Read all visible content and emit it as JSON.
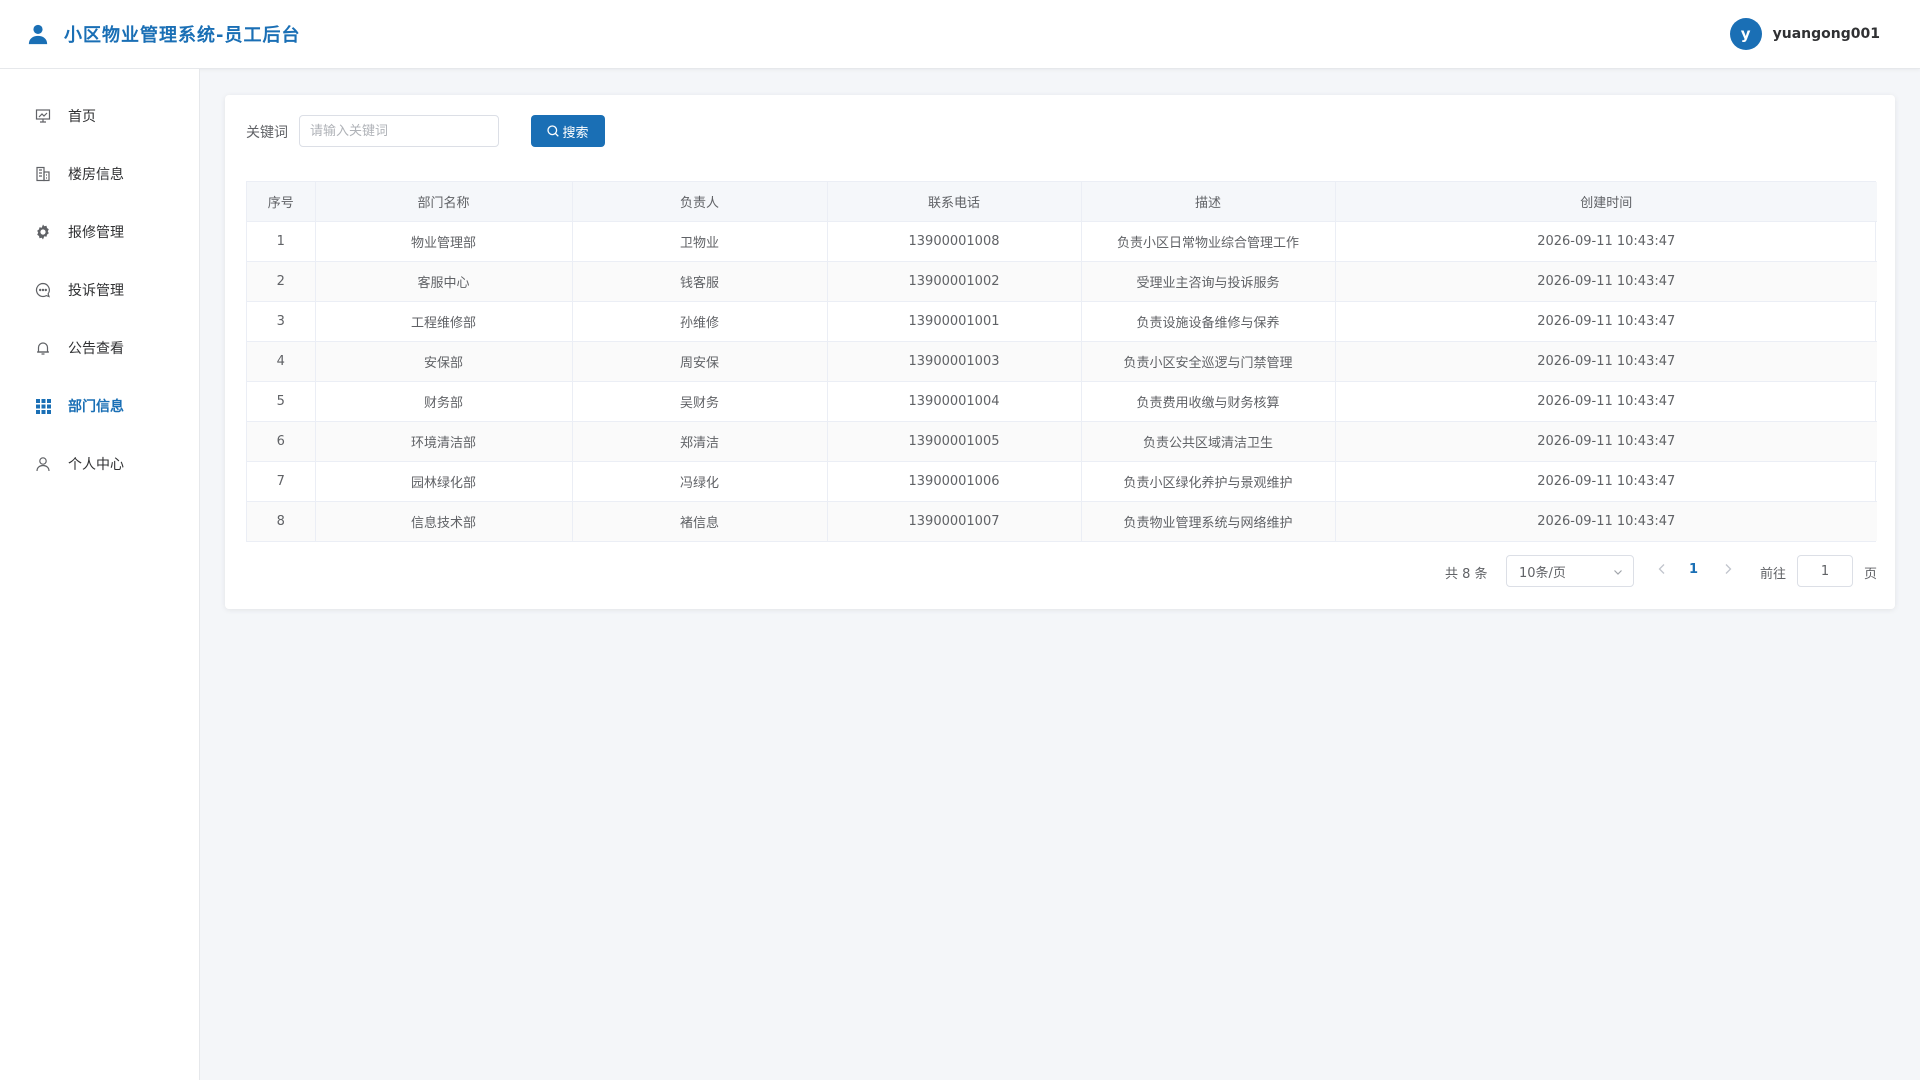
{
  "header": {
    "title": "小区物业管理系统-员工后台",
    "avatar_letter": "y",
    "username": "yuangong001"
  },
  "sidebar": {
    "items": [
      {
        "label": "首页",
        "icon": "presentation-icon"
      },
      {
        "label": "楼房信息",
        "icon": "building-icon"
      },
      {
        "label": "报修管理",
        "icon": "gear-icon"
      },
      {
        "label": "投诉管理",
        "icon": "chat-icon"
      },
      {
        "label": "公告查看",
        "icon": "bell-icon"
      },
      {
        "label": "部门信息",
        "icon": "grid-icon",
        "active": true
      },
      {
        "label": "个人中心",
        "icon": "user-icon"
      }
    ]
  },
  "search": {
    "label": "关键词",
    "placeholder": "请输入关键词",
    "value": "",
    "button_label": "搜索"
  },
  "table": {
    "columns": [
      "序号",
      "部门名称",
      "负责人",
      "联系电话",
      "描述",
      "创建时间"
    ],
    "rows": [
      [
        "1",
        "物业管理部",
        "卫物业",
        "13900001008",
        "负责小区日常物业综合管理工作",
        "2026-09-11 10:43:47"
      ],
      [
        "2",
        "客服中心",
        "钱客服",
        "13900001002",
        "受理业主咨询与投诉服务",
        "2026-09-11 10:43:47"
      ],
      [
        "3",
        "工程维修部",
        "孙维修",
        "13900001001",
        "负责设施设备维修与保养",
        "2026-09-11 10:43:47"
      ],
      [
        "4",
        "安保部",
        "周安保",
        "13900001003",
        "负责小区安全巡逻与门禁管理",
        "2026-09-11 10:43:47"
      ],
      [
        "5",
        "财务部",
        "吴财务",
        "13900001004",
        "负责费用收缴与财务核算",
        "2026-09-11 10:43:47"
      ],
      [
        "6",
        "环境清洁部",
        "郑清洁",
        "13900001005",
        "负责公共区域清洁卫生",
        "2026-09-11 10:43:47"
      ],
      [
        "7",
        "园林绿化部",
        "冯绿化",
        "13900001006",
        "负责小区绿化养护与景观维护",
        "2026-09-11 10:43:47"
      ],
      [
        "8",
        "信息技术部",
        "褚信息",
        "13900001007",
        "负责物业管理系统与网络维护",
        "2026-09-11 10:43:47"
      ]
    ]
  },
  "pagination": {
    "total_text": "共 8 条",
    "page_size": "10条/页",
    "current_page": "1",
    "goto_label": "前往",
    "goto_value": "1",
    "page_unit": "页"
  },
  "colors": {
    "primary": "#1a6fb5",
    "background": "#f4f6f9"
  }
}
